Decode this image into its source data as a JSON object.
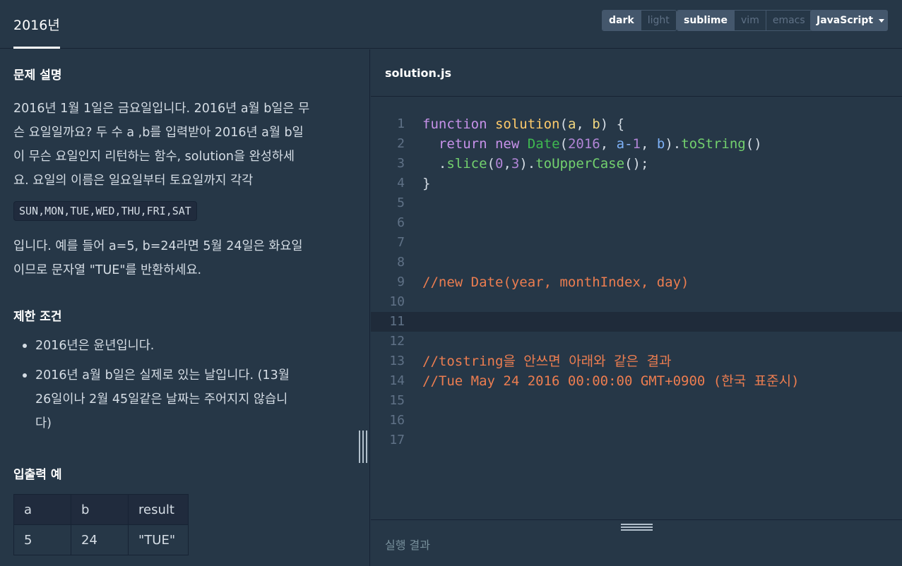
{
  "header": {
    "title": "2016년",
    "theme_options": [
      {
        "label": "dark",
        "active": true
      },
      {
        "label": "light",
        "active": false
      }
    ],
    "keymap_options": [
      {
        "label": "sublime",
        "active": true
      },
      {
        "label": "vim",
        "active": false
      },
      {
        "label": "emacs",
        "active": false
      }
    ],
    "language": "JavaScript"
  },
  "problem": {
    "section_title": "문제 설명",
    "desc_lines": [
      "2016년 1월 1일은 금요일입니다. 2016년 a월 b일은 무",
      "슨 요일일까요? 두 수 a ,b를 입력받아 2016년 a월 b일",
      "이 무슨 요일인지 리턴하는 함수, solution을 완성하세",
      "요. 요일의 이름은 일요일부터 토요일까지 각각"
    ],
    "days_code": "SUN,MON,TUE,WED,THU,FRI,SAT",
    "desc_after_lines": [
      "입니다. 예를 들어 a=5, b=24라면 5월 24일은 화요일",
      "이므로 문자열 \"TUE\"를 반환하세요."
    ],
    "limits_title": "제한 조건",
    "limits": [
      {
        "lines": [
          "2016년은 윤년입니다."
        ]
      },
      {
        "lines": [
          "2016년 a월 b일은 실제로 있는 날입니다. (13월",
          "26일이나 2월 45일같은 날짜는 주어지지 않습니",
          "다)"
        ]
      }
    ],
    "io_title": "입출력 예",
    "io_table": {
      "headers": [
        "a",
        "b",
        "result"
      ],
      "rows": [
        [
          "5",
          "24",
          "\"TUE\""
        ]
      ]
    }
  },
  "editor": {
    "filename": "solution.js",
    "line_numbers": [
      "1",
      "2",
      "3",
      "4",
      "5",
      "6",
      "7",
      "8",
      "9",
      "10",
      "11",
      "12",
      "13",
      "14",
      "15",
      "16",
      "17"
    ],
    "active_line": 11,
    "code": {
      "l1": {
        "kw": "function",
        "fn": "solution",
        "p1": "a",
        "p2": "b"
      },
      "l2": {
        "kw1": "return",
        "kw2": "new",
        "cls": "Date",
        "n1": "2016",
        "v1": "a",
        "n2": "1",
        "v2": "b",
        "m": "toString"
      },
      "l3": {
        "m1": "slice",
        "n1": "0",
        "n2": "3",
        "m2": "toUpperCase"
      },
      "l4": "}",
      "l9": "//new Date(year, monthIndex, day)",
      "l13": "//tostring을 안쓰면 아래와 같은 결과",
      "l14": "//Tue May 24 2016 00:00:00 GMT+0900 (한국 표준시)"
    }
  },
  "result": {
    "label": "실행 결과"
  }
}
